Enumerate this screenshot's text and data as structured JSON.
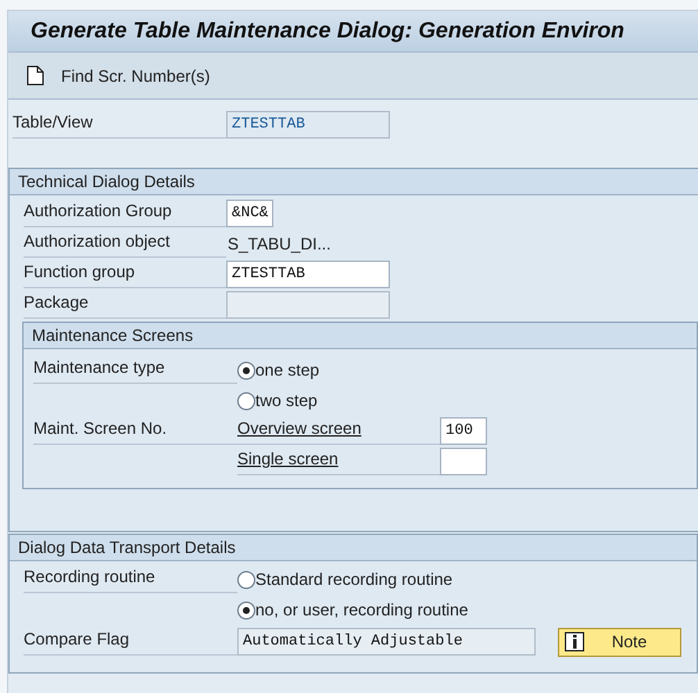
{
  "window": {
    "title": "Generate Table Maintenance Dialog: Generation Environ"
  },
  "toolbar": {
    "buttons": [
      {
        "label": "Find Scr. Number(s)"
      }
    ]
  },
  "table_view": {
    "label": "Table/View",
    "kind": "key",
    "value": "ZTESTTAB"
  },
  "technical_details": {
    "title": "Technical Dialog Details",
    "fields": [
      {
        "label": "Authorization Group",
        "kind": "short_input",
        "value": "&NC&"
      },
      {
        "label": "Authorization object",
        "kind": "display",
        "value": "S_TABU_DI..."
      },
      {
        "label": "Function group",
        "kind": "input",
        "value": "ZTESTTAB"
      },
      {
        "label": "Package",
        "kind": "readonly"
      }
    ],
    "maintenance_screens": {
      "title": "Maintenance Screens",
      "type_label": "Maintenance type",
      "types": [
        {
          "label": "one step",
          "selected": true
        },
        {
          "label": "two step",
          "selected": false
        }
      ],
      "screen_no_label": "Maint. Screen No.",
      "screens": [
        {
          "label": "Overview screen",
          "value": "100"
        },
        {
          "label": "Single screen"
        }
      ]
    }
  },
  "transport_details": {
    "title": "Dialog Data Transport Details",
    "routine_label": "Recording routine",
    "routines": [
      {
        "label": "Standard recording routine",
        "selected": false
      },
      {
        "label": "no, or user, recording routine",
        "selected": true
      }
    ],
    "compare_label": "Compare Flag",
    "compare_value": "Automatically Adjustable",
    "note_button": "Note"
  }
}
